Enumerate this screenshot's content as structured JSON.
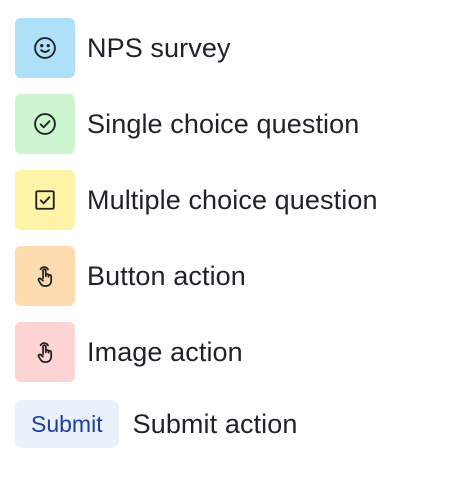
{
  "items": [
    {
      "label": "NPS survey",
      "icon": "smiley-face-icon",
      "tile_color": "#aee0f7"
    },
    {
      "label": "Single choice question",
      "icon": "check-circle-icon",
      "tile_color": "#cdf5cf"
    },
    {
      "label": "Multiple choice question",
      "icon": "check-square-icon",
      "tile_color": "#fef3a6"
    },
    {
      "label": "Button action",
      "icon": "tap-hand-icon",
      "tile_color": "#fedcb0"
    },
    {
      "label": "Image action",
      "icon": "tap-hand-icon",
      "tile_color": "#fed4d4"
    }
  ],
  "submit": {
    "button_label": "Submit",
    "label": "Submit action",
    "button_bg": "#eaf1fb",
    "button_text_color": "#1d3ea0"
  },
  "colors": {
    "icon_stroke": "#1f2328",
    "text": "#1f2328"
  }
}
